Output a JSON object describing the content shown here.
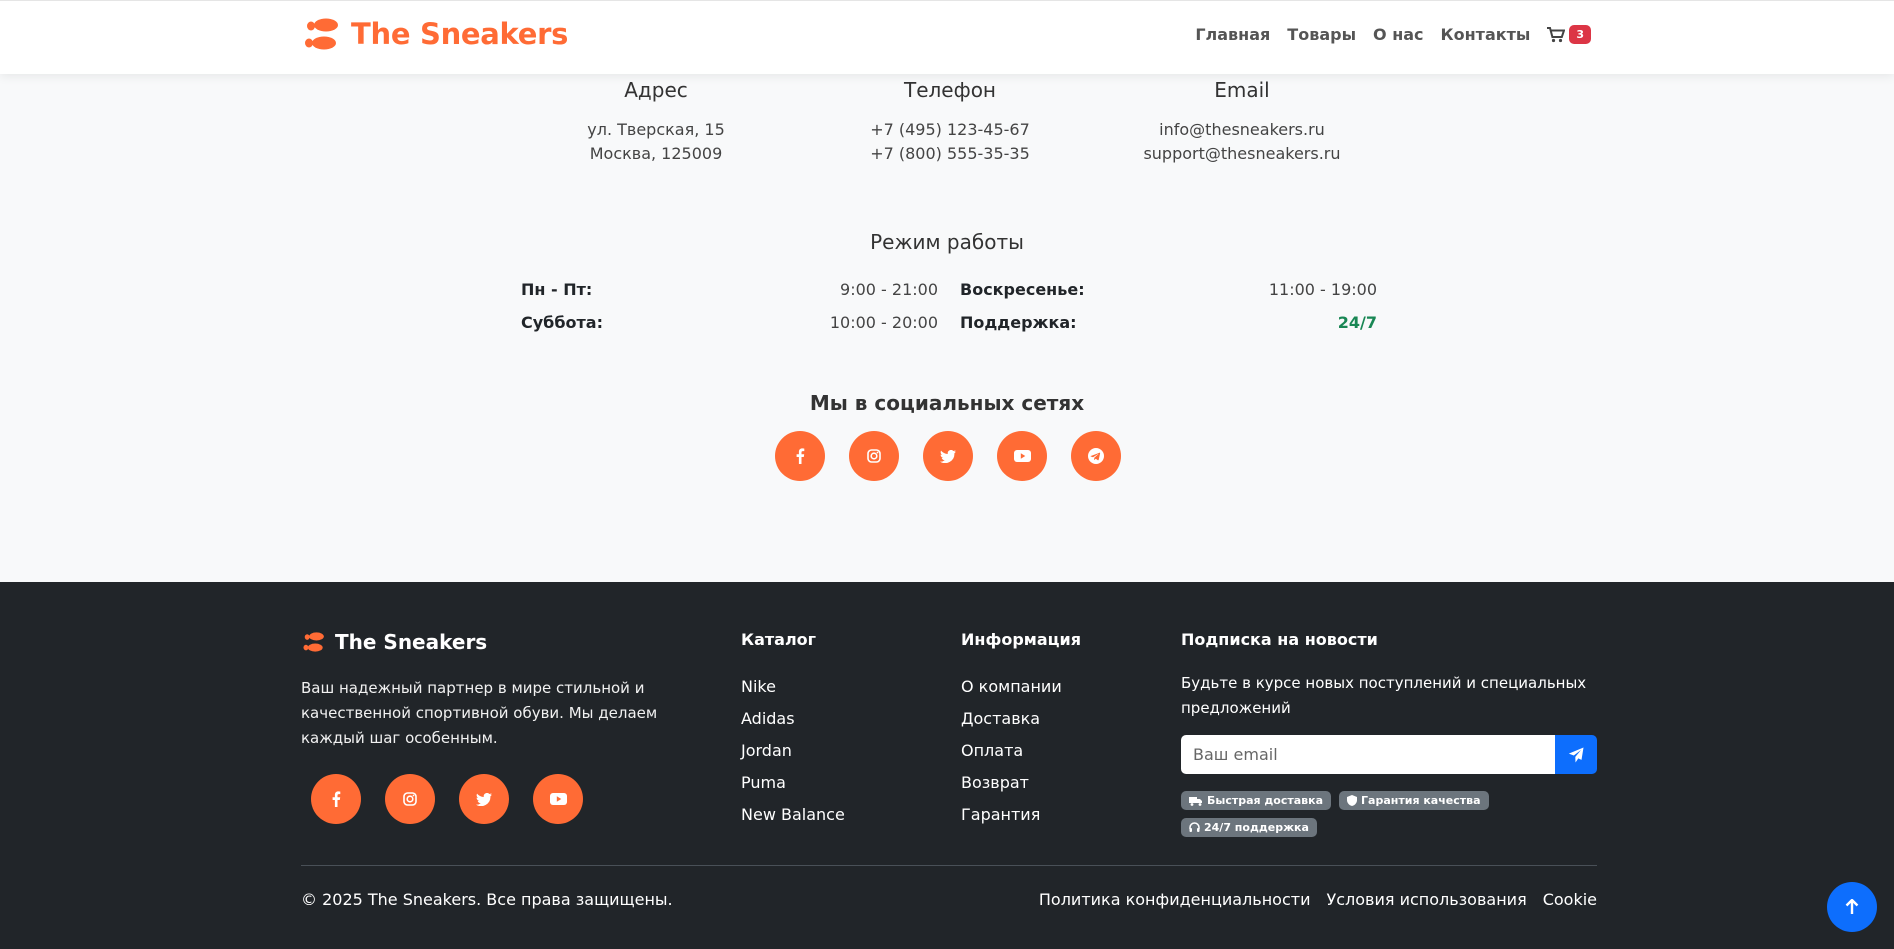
{
  "header": {
    "brand": "The Sneakers",
    "nav": [
      "Главная",
      "Товары",
      "О нас",
      "Контакты"
    ],
    "cart_count": "3"
  },
  "contacts": {
    "address": {
      "title": "Адрес",
      "line1": "ул. Тверская, 15",
      "line2": "Москва, 125009"
    },
    "phone": {
      "title": "Телефон",
      "line1": "+7 (495) 123-45-67",
      "line2": "+7 (800) 555-35-35"
    },
    "email": {
      "title": "Email",
      "line1": "info@thesneakers.ru",
      "line2": "support@thesneakers.ru"
    }
  },
  "hours": {
    "title": "Режим работы",
    "rows": [
      {
        "day": "Пн - Пт:",
        "time": "9:00 - 21:00"
      },
      {
        "day": "Воскресенье:",
        "time": "11:00 - 19:00"
      },
      {
        "day": "Суббота:",
        "time": "10:00 - 20:00"
      },
      {
        "day": "Поддержка:",
        "time": "24/7"
      }
    ]
  },
  "social": {
    "title": "Мы в социальных сетях",
    "icons": [
      "facebook-icon",
      "instagram-icon",
      "twitter-icon",
      "youtube-icon",
      "telegram-icon"
    ]
  },
  "footer": {
    "brand": "The Sneakers",
    "description": "Ваш надежный партнер в мире стильной и качественной спортивной обуви. Мы делаем каждый шаг особенным.",
    "catalog": {
      "title": "Каталог",
      "links": [
        "Nike",
        "Adidas",
        "Jordan",
        "Puma",
        "New Balance"
      ]
    },
    "info": {
      "title": "Информация",
      "links": [
        "О компании",
        "Доставка",
        "Оплата",
        "Возврат",
        "Гарантия"
      ]
    },
    "subscribe": {
      "title": "Подписка на новости",
      "text": "Будьте в курсе новых поступлений и специальных предложений",
      "placeholder": "Ваш email",
      "badges": [
        "Быстрая доставка",
        "Гарантия качества",
        "24/7 поддержка"
      ]
    },
    "copyright": "© 2025 The Sneakers. Все права защищены.",
    "legal": [
      "Политика конфиденциальности",
      "Условия использования",
      "Cookie"
    ]
  },
  "colors": {
    "accent": "#ff6b35",
    "footer_bg": "#212529",
    "primary": "#0d6efd",
    "success": "#198754",
    "danger": "#dc3545"
  }
}
